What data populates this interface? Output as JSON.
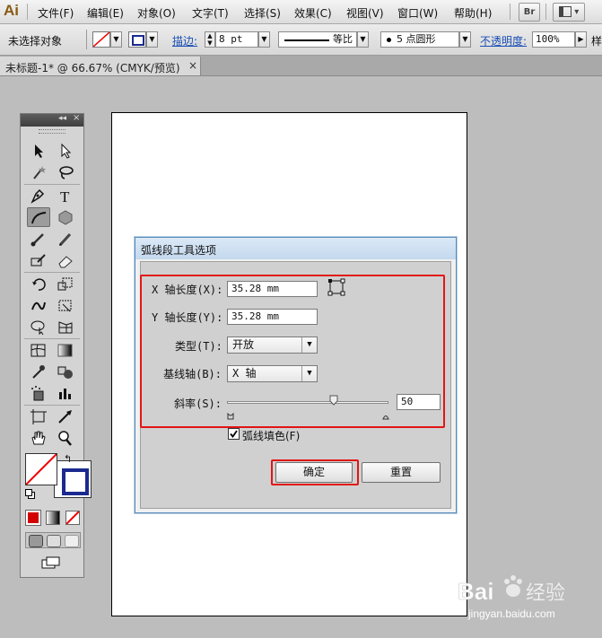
{
  "app": {
    "logo": "Ai"
  },
  "menu": {
    "items": [
      "文件(F)",
      "编辑(E)",
      "对象(O)",
      "文字(T)",
      "选择(S)",
      "效果(C)",
      "视图(V)",
      "窗口(W)",
      "帮助(H)"
    ],
    "bridge_button": "Br"
  },
  "control_bar": {
    "selection_status": "未选择对象",
    "stroke_label": "描边:",
    "stroke_weight": "8 pt",
    "stroke_profile": "等比",
    "brush": "5 点圆形",
    "opacity_label": "不透明度:",
    "opacity_value": "100%",
    "style_label": "样"
  },
  "document_tab": {
    "title": "未标题-1* @ 66.67% (CMYK/预览)",
    "close": "×"
  },
  "dialog": {
    "title": "弧线段工具选项",
    "x_axis_length_label": "X 轴长度(X):",
    "x_axis_length_value": "35.28 mm",
    "y_axis_length_label": "Y 轴长度(Y):",
    "y_axis_length_value": "35.28 mm",
    "type_label": "类型(T):",
    "type_value": "开放",
    "base_axis_label": "基线轴(B):",
    "base_axis_value": "X 轴",
    "slope_label": "斜率(S):",
    "slope_value": "50",
    "slope_level": 0.66,
    "fill_arc_label": "弧线填色(F)",
    "fill_arc_checked": true,
    "ok_button": "确定",
    "reset_button": "重置"
  },
  "colors": {
    "annotation_red": "#e21515",
    "stroke_swatch": "#1b2a8f"
  },
  "watermark": {
    "text": "Baidu经验",
    "url": "jingyan.baidu.com"
  }
}
